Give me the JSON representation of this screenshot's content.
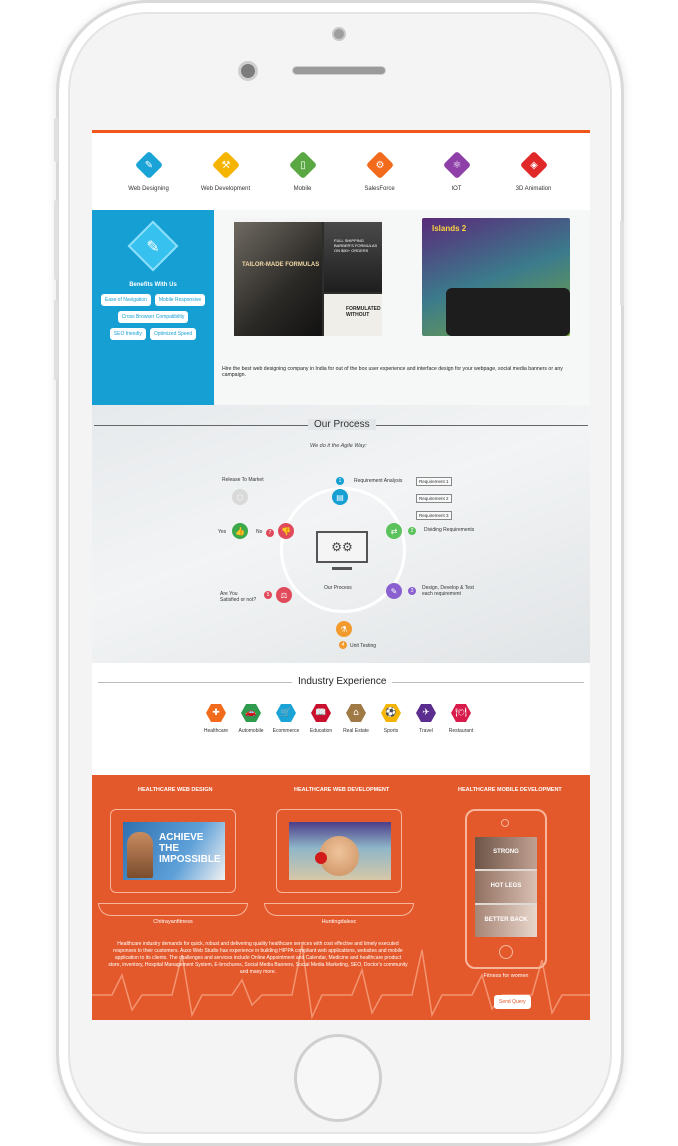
{
  "services": [
    {
      "label": "Web Designing",
      "icon": "design-tools-icon",
      "color": "#1aa3d6",
      "glyph": "✎"
    },
    {
      "label": "Web Development",
      "icon": "dev-tools-icon",
      "color": "#f4b400",
      "glyph": "⚒"
    },
    {
      "label": "Mobile",
      "icon": "mobile-icon",
      "color": "#5aa843",
      "glyph": "▯"
    },
    {
      "label": "SalesForce",
      "icon": "gear-icon",
      "color": "#f26a1b",
      "glyph": "⚙"
    },
    {
      "label": "IOT",
      "icon": "iot-icon",
      "color": "#8e3fa8",
      "glyph": "⚛"
    },
    {
      "label": "3D Animation",
      "icon": "cube-icon",
      "color": "#e02828",
      "glyph": "◈"
    }
  ],
  "benefits": {
    "title": "Benefits With Us",
    "tags": [
      "Ease of Navigation",
      "Mobile Responsive",
      "Cross Browser Compatibility",
      "SEO friendly",
      "Optimized Speed"
    ]
  },
  "showcase": {
    "shot1_headline": "TAILOR-MADE FORMULAS",
    "shot1_side": "FULL SHIPPING BARBER'S FORMULAS ON $50+ ORDERS",
    "shot1_product": "FORMULATED WITHOUT",
    "shot2_logo": "Islands 2",
    "description": "Hire the best web designing company in India for out of the box user experience and interface design for your webpage, social media banners or any campaign."
  },
  "process": {
    "title": "Our Process",
    "subtitle": "We do it the Agile Way:",
    "center_label": "Our Process",
    "release": "Release To Market",
    "yes": "Yes",
    "no": "No",
    "requirement_analysis": "Requirement Analysis",
    "requirements": [
      "Requirement 1",
      "Requirement 2",
      "Requirement 3"
    ],
    "dividing": "Dividing Requirements",
    "design": "Design, Develop & Test each requirement",
    "unit_testing": "Unit Testing",
    "satisfied": "Are You Satisfied or not?"
  },
  "industry": {
    "title": "Industry Experience",
    "items": [
      {
        "label": "Healthcare",
        "icon": "stethoscope-icon",
        "color": "#f26a1b",
        "glyph": "✚"
      },
      {
        "label": "Automobile",
        "icon": "car-icon",
        "color": "#2e9b4f",
        "glyph": "🚗"
      },
      {
        "label": "Ecommerce",
        "icon": "cart-icon",
        "color": "#1aa3d6",
        "glyph": "🛒"
      },
      {
        "label": "Education",
        "icon": "book-icon",
        "color": "#c8102e",
        "glyph": "📖"
      },
      {
        "label": "Real Estate",
        "icon": "house-icon",
        "color": "#a07a45",
        "glyph": "⌂"
      },
      {
        "label": "Sports",
        "icon": "sports-icon",
        "color": "#f4b400",
        "glyph": "⚽"
      },
      {
        "label": "Travel",
        "icon": "plane-icon",
        "color": "#5b2d8e",
        "glyph": "✈"
      },
      {
        "label": "Restaurant",
        "icon": "dining-icon",
        "color": "#d81b4a",
        "glyph": "🍽"
      }
    ]
  },
  "healthcare": {
    "col1": "HEALTHCARE WEB DESIGN",
    "col2": "HEALTHCARE WEB DEVELOPMENT",
    "col3": "HEALTHCARE MOBILE DEVELOPMENT",
    "lap1_text": "ACHIEVE THE IMPOSSIBLE",
    "cap1": "Chitrayanfitness",
    "cap2": "Huntingdalesc",
    "cap3": "Fitness for women",
    "phone_p1": "STRONG",
    "phone_p2": "HOT LEGS",
    "phone_p3": "BETTER BACK",
    "description": "Healthcare industry demands for quick, robust and delivering quality healthcare services with cost effective and timely executed responses to their customers. Auxo Web Studio has experience in building HIPPA compliant web applications, websites and mobile application to its clients. The challenges and services include Online Appointment and Calendar, Medicine and healthcare product store, inventory, Hospital Management System, E-brochures, Social Media Banners, Social Media Marketing, SEO, Doctor's community and many more.",
    "button": "Send Query"
  }
}
